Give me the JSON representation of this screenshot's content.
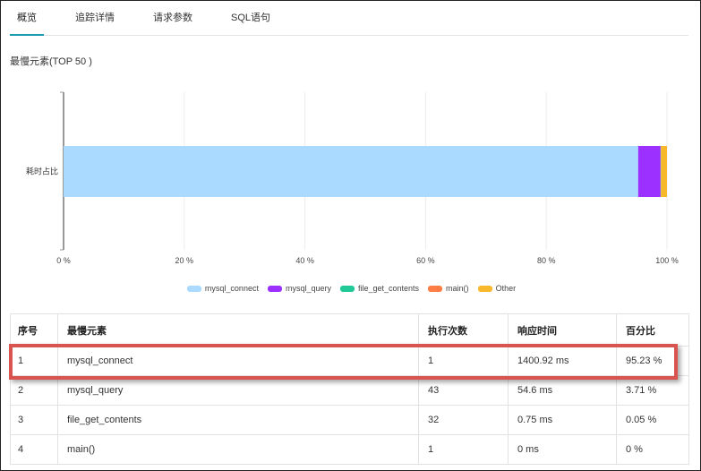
{
  "tabs": [
    {
      "label": "概览",
      "active": true
    },
    {
      "label": "追踪详情",
      "active": false
    },
    {
      "label": "请求参数",
      "active": false
    },
    {
      "label": "SQL语句",
      "active": false
    }
  ],
  "section_title": "最慢元素(TOP 50 )",
  "chart_data": {
    "type": "bar",
    "orientation": "horizontal",
    "stacked": true,
    "categories": [
      "耗时占比"
    ],
    "series": [
      {
        "name": "mysql_connect",
        "values": [
          95.23
        ],
        "color": "#aadaff"
      },
      {
        "name": "mysql_query",
        "values": [
          3.71
        ],
        "color": "#9b30ff"
      },
      {
        "name": "file_get_contents",
        "values": [
          0.05
        ],
        "color": "#20c997"
      },
      {
        "name": "main()",
        "values": [
          0
        ],
        "color": "#fd7e45"
      },
      {
        "name": "Other",
        "values": [
          1.01
        ],
        "color": "#f8b82c"
      }
    ],
    "xlim": [
      0,
      100
    ],
    "xticks": [
      "0 %",
      "20 %",
      "40 %",
      "60 %",
      "80 %",
      "100 %"
    ],
    "grid": true,
    "legend": "bottom"
  },
  "table": {
    "headers": [
      "序号",
      "最慢元素",
      "执行次数",
      "响应时间",
      "百分比"
    ],
    "rows": [
      [
        "1",
        "mysql_connect",
        "1",
        "1400.92 ms",
        "95.23 %"
      ],
      [
        "2",
        "mysql_query",
        "43",
        "54.6 ms",
        "3.71 %"
      ],
      [
        "3",
        "file_get_contents",
        "32",
        "0.75 ms",
        "0.05 %"
      ],
      [
        "4",
        "main()",
        "1",
        "0 ms",
        "0 %"
      ]
    ]
  },
  "colors": {
    "accent": "#1a9bb0",
    "highlight": "#d9534f"
  }
}
